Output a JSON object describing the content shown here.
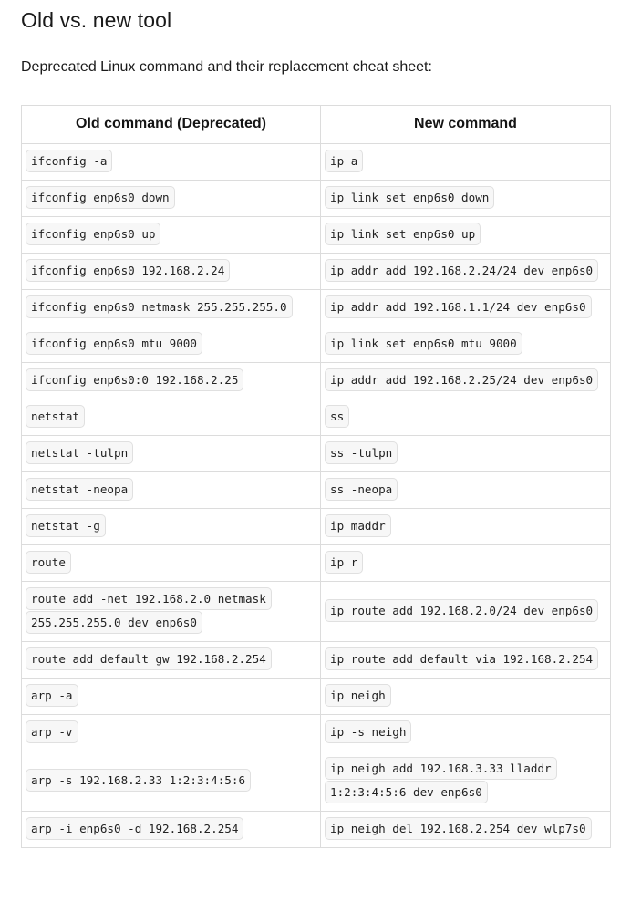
{
  "page": {
    "title": "Old vs. new tool",
    "intro": "Deprecated Linux command and their replacement cheat sheet:"
  },
  "table": {
    "headers": {
      "old": "Old command (Deprecated)",
      "new": "New command"
    },
    "rows": [
      {
        "old": "ifconfig -a",
        "new": "ip a"
      },
      {
        "old": "ifconfig enp6s0 down",
        "new": "ip link set enp6s0 down"
      },
      {
        "old": "ifconfig enp6s0 up",
        "new": "ip link set enp6s0 up"
      },
      {
        "old": "ifconfig enp6s0 192.168.2.24",
        "new": "ip addr add 192.168.2.24/24 dev enp6s0"
      },
      {
        "old": "ifconfig enp6s0 netmask 255.255.255.0",
        "new": "ip addr add 192.168.1.1/24 dev enp6s0"
      },
      {
        "old": "ifconfig enp6s0 mtu 9000",
        "new": "ip link set enp6s0 mtu 9000"
      },
      {
        "old": "ifconfig enp6s0:0 192.168.2.25",
        "new": "ip addr add 192.168.2.25/24 dev enp6s0"
      },
      {
        "old": "netstat",
        "new": "ss"
      },
      {
        "old": "netstat -tulpn",
        "new": "ss -tulpn"
      },
      {
        "old": "netstat -neopa",
        "new": "ss -neopa"
      },
      {
        "old": "netstat -g",
        "new": "ip maddr"
      },
      {
        "old": "route",
        "new": "ip r"
      },
      {
        "old": "route add -net 192.168.2.0 netmask 255.255.255.0 dev enp6s0",
        "new": "ip route add 192.168.2.0/24 dev enp6s0"
      },
      {
        "old": "route add default gw 192.168.2.254",
        "new": "ip route add default via 192.168.2.254"
      },
      {
        "old": "arp -a",
        "new": "ip neigh"
      },
      {
        "old": "arp -v",
        "new": "ip -s neigh"
      },
      {
        "old": "arp -s 192.168.2.33 1:2:3:4:5:6",
        "new": "ip neigh add 192.168.3.33 lladdr 1:2:3:4:5:6 dev enp6s0"
      },
      {
        "old": "arp -i enp6s0 -d 192.168.2.254",
        "new": "ip neigh del 192.168.2.254 dev wlp7s0"
      }
    ]
  },
  "colors": {
    "border": "#dcdcdc",
    "code_bg": "#f7f7f7",
    "code_border": "#e0e0e0",
    "text": "#1a1a1a"
  }
}
